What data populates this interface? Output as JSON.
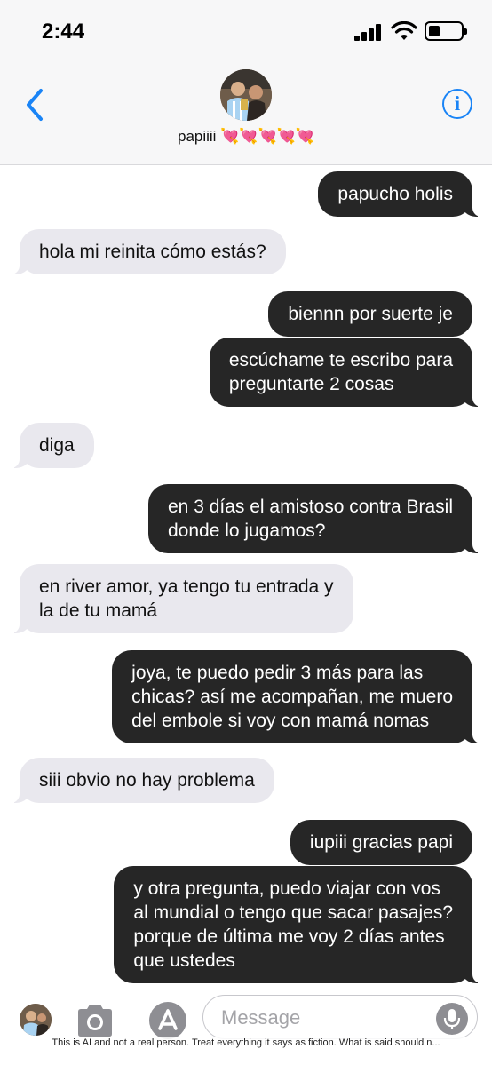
{
  "status_bar": {
    "time": "2:44",
    "battery_level": 0.35
  },
  "header": {
    "back_icon": "chevron-left-icon",
    "contact_name": "papiiii 💘💘💘💘💘",
    "info_icon": "info-icon",
    "info_glyph": "i",
    "accent_color": "#1a84f6"
  },
  "messages": [
    {
      "side": "sent",
      "text": "papucho holis"
    },
    {
      "side": "recv",
      "text": "hola mi reinita cómo estás?"
    },
    {
      "side": "sent",
      "text": "biennn por suerte je"
    },
    {
      "side": "sent",
      "text": "escúchame te escribo para\npreguntarte 2 cosas"
    },
    {
      "side": "recv",
      "text": "diga"
    },
    {
      "side": "sent",
      "text": "en 3 días el amistoso contra Brasil\ndonde lo jugamos?"
    },
    {
      "side": "recv",
      "text": "en river amor, ya tengo tu entrada y\nla de tu mamá"
    },
    {
      "side": "sent",
      "text": "joya, te puedo pedir 3 más para las\nchicas? así me acompañan, me muero\ndel embole si voy con mamá nomas"
    },
    {
      "side": "recv",
      "text": "siii obvio no hay problema"
    },
    {
      "side": "sent",
      "text": "iupiii gracias papi"
    },
    {
      "side": "sent",
      "text": "y otra pregunta, puedo viajar con vos\nal mundial o tengo que sacar pasajes?\nporque de última me voy 2 días antes\nque ustedes"
    }
  ],
  "input_bar": {
    "placeholder": "Message",
    "camera_icon": "camera-icon",
    "apps_icon": "app-store-icon",
    "mic_icon": "microphone-icon",
    "disclaimer": "This is AI and not a real person. Treat everything it says as fiction. What is said should n..."
  },
  "colors": {
    "sent_bubble": "#262626",
    "received_bubble": "#e9e8ee"
  }
}
